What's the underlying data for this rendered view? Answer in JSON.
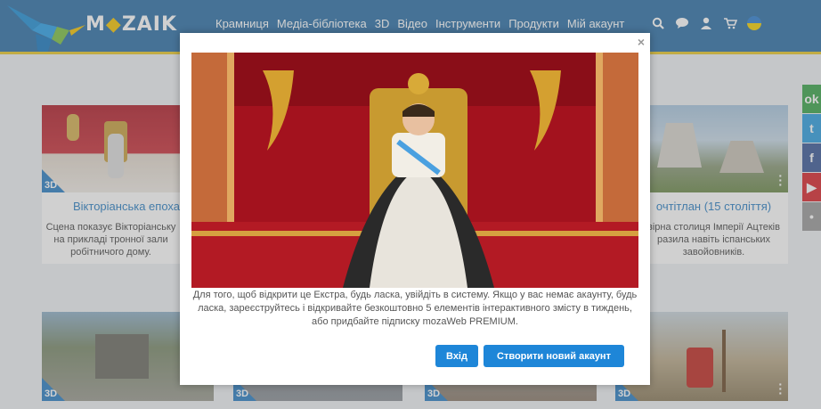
{
  "header": {
    "logo_text_pre": "M",
    "logo_text_dia": "◆",
    "logo_text_post": "ZAIK",
    "nav": [
      "Крамниця",
      "Медіа-бібліотека",
      "3D",
      "Відео",
      "Інструменти",
      "Продукти",
      "Мій акаунт"
    ],
    "icons": [
      "search-icon",
      "chat-icon",
      "user-icon",
      "cart-icon",
      "language-flag-icon"
    ]
  },
  "cards_row1": [
    {
      "title": "Вікторіанська епоха",
      "desc": "Сцена показує Вікторіанську на прикладі тронної зали робітничого дому.",
      "badge": "3D"
    },
    {
      "title": "очтітлан (15 століття)",
      "desc": "вірна столиця Імперії Ацтеків разила навіть іспанських завойовників.",
      "badge": "3D"
    }
  ],
  "cards_row2_badges": [
    "3D",
    "3D",
    "3D",
    "3D"
  ],
  "social": [
    "ok-icon",
    "twitter-icon",
    "facebook-icon",
    "youtube-icon",
    "other-icon"
  ],
  "modal": {
    "close": "×",
    "text": "Для того, щоб відкрити це Екстра, будь ласка, увійдіть в систему. Якщо у вас немає акаунту, будь ласка, зареєструйтесь і відкривайте безкоштовно 5 елементів інтерактивного змісту в тиждень, або придбайте підписку mozaWeb PREMIUM.",
    "login_button": "Вхід",
    "register_button": "Створити новий акаунт"
  },
  "colors": {
    "header_bg": "#2b6fa6",
    "accent": "#2a7fc4",
    "button": "#1e86d8"
  }
}
